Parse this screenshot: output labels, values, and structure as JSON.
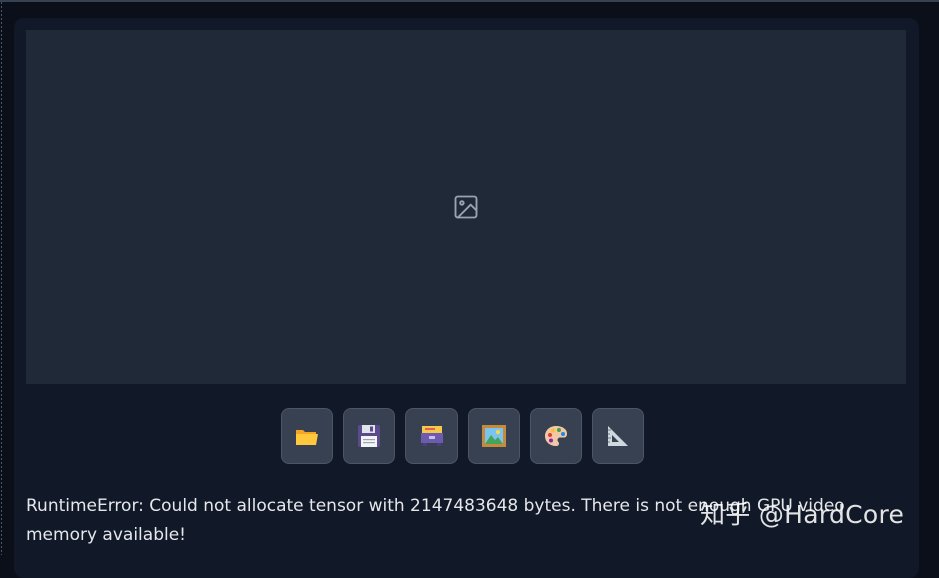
{
  "image_placeholder": {
    "icon": "image-placeholder-icon"
  },
  "toolbar": {
    "buttons": [
      {
        "name": "open-folder-button",
        "icon": "folder-icon"
      },
      {
        "name": "save-button",
        "icon": "floppy-disk-icon"
      },
      {
        "name": "send-button",
        "icon": "card-file-box-icon"
      },
      {
        "name": "send-to-img2img-button",
        "icon": "framed-picture-icon"
      },
      {
        "name": "send-to-inpaint-button",
        "icon": "palette-icon"
      },
      {
        "name": "send-to-extras-button",
        "icon": "triangular-ruler-icon"
      }
    ]
  },
  "error": {
    "message": "RuntimeError: Could not allocate tensor with 2147483648 bytes. There is not enough GPU video memory available!"
  },
  "watermark": {
    "text": "知乎 @HardCore"
  },
  "colors": {
    "page_bg": "#0b0f19",
    "panel_bg": "#111827",
    "image_area_bg": "#1f2937",
    "button_bg": "#374151",
    "text": "#e5e7eb"
  }
}
